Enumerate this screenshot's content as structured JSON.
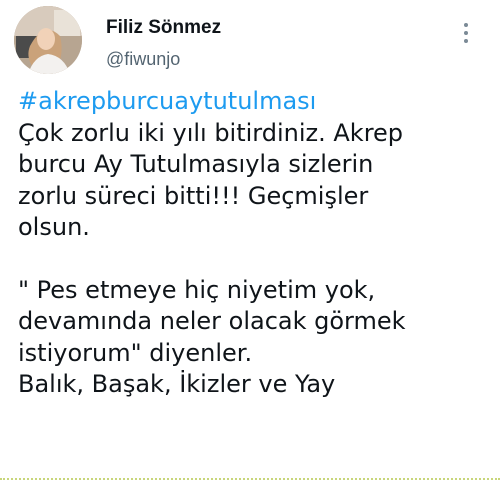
{
  "author": {
    "display_name": "Filiz Sönmez",
    "handle": "@fiwunjo",
    "avatar_icon": "profile-photo"
  },
  "more_icon": "vertical-ellipsis-icon",
  "tweet": {
    "hashtag": "#akrepburcuaytutulması",
    "paragraph1": [
      "Çok zorlu iki yılı bitirdiniz. Akrep",
      "burcu Ay Tutulmasıyla sizlerin",
      "zorlu süreci bitti!!! Geçmişler",
      "olsun."
    ],
    "paragraph2": [
      "\" Pes etmeye hiç niyetim yok,",
      "devamında neler olacak görmek",
      "istiyorum\" diyenler.",
      "Balık, Başak, İkizler ve Yay"
    ]
  },
  "colors": {
    "hashtag": "#1d9bf0",
    "text": "#0f1419",
    "secondary": "#536471"
  }
}
